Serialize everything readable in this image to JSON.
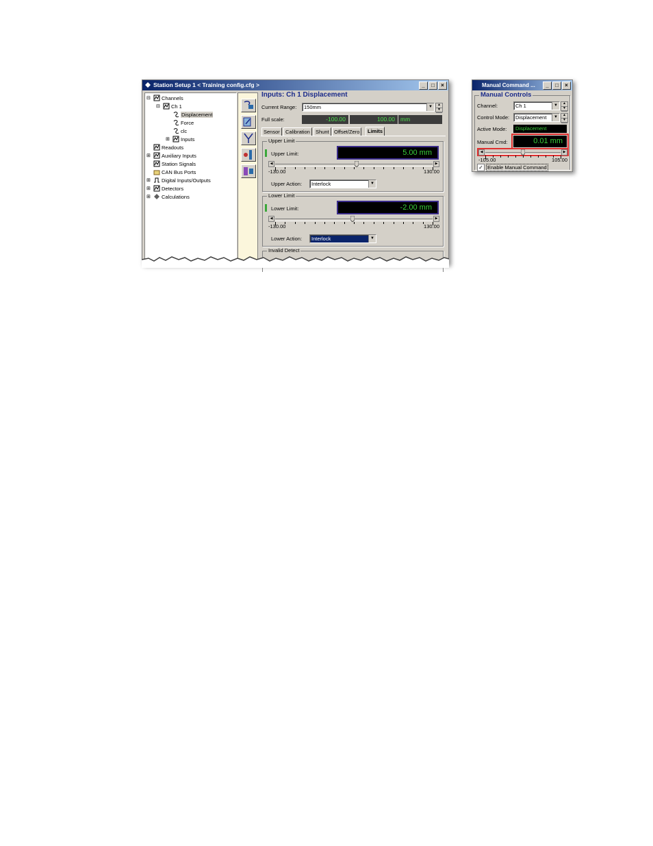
{
  "station_window": {
    "title": "Station Setup 1 < Training config.cfg >",
    "tree": [
      {
        "label": "Channels",
        "expander": "⊟",
        "icon": "channels-icon"
      },
      {
        "label": "Ch 1",
        "expander": "⊟",
        "icon": "channel-icon"
      },
      {
        "label": "Displacement",
        "expander": "",
        "icon": "sensor-icon",
        "selected": true
      },
      {
        "label": "Force",
        "expander": "",
        "icon": "sensor-icon"
      },
      {
        "label": "clc",
        "expander": "",
        "icon": "sensor-icon"
      },
      {
        "label": "Inputs",
        "expander": "⊞",
        "icon": "inputs-icon"
      },
      {
        "label": "Readouts",
        "expander": "",
        "icon": "readouts-icon"
      },
      {
        "label": "Auxiliary Inputs",
        "expander": "⊞",
        "icon": "aux-inputs-icon"
      },
      {
        "label": "Station Signals",
        "expander": "",
        "icon": "signals-icon"
      },
      {
        "label": "CAN Bus Ports",
        "expander": "",
        "icon": "folder-icon"
      },
      {
        "label": "Digital Inputs/Outputs",
        "expander": "⊞",
        "icon": "digital-io-icon"
      },
      {
        "label": "Detectors",
        "expander": "⊞",
        "icon": "detectors-icon"
      },
      {
        "label": "Calculations",
        "expander": "⊞",
        "icon": "calculations-icon"
      }
    ],
    "toolbar_icons": [
      "channel-config-icon",
      "calibration-tool-icon",
      "fork-icon",
      "sensor-probe-icon",
      "station-icon"
    ],
    "panel": {
      "heading": "Inputs: Ch 1 Displacement",
      "current_range_label": "Current Range:",
      "current_range_value": "150mm",
      "full_scale_label": "Full scale:",
      "full_scale_min": "-100.00",
      "full_scale_max": "100.00",
      "full_scale_unit": "mm",
      "tabs": [
        "Sensor",
        "Calibration",
        "Shunt",
        "Offset/Zero",
        "Limits"
      ],
      "active_tab": "Limits",
      "upper": {
        "group_title": "Upper Limit",
        "limit_label": "Upper Limit:",
        "readout": "5.00  mm",
        "slider_min": "-130.00",
        "slider_max": "130.00",
        "slider_value": 5,
        "action_label": "Upper Action:",
        "action_value": "Interlock"
      },
      "lower": {
        "group_title": "Lower Limit",
        "limit_label": "Lower Limit:",
        "readout": "-2.00  mm",
        "slider_min": "-130.00",
        "slider_max": "130.00",
        "slider_value": -2,
        "action_label": "Lower Action:",
        "action_value": "Interlock"
      },
      "invalid_detect_title": "Invalid Detect"
    }
  },
  "manual_window": {
    "title": "Manual Command ...",
    "group_title": "Manual Controls",
    "channel_label": "Channel:",
    "channel_value": "Ch 1",
    "control_mode_label": "Control Mode:",
    "control_mode_value": "Displacement",
    "active_mode_label": "Active Mode:",
    "active_mode_value": "Displacement",
    "manual_cmd_label": "Manual Cmd:",
    "manual_cmd_readout": "0.01  mm",
    "slider_min": "-105.00",
    "slider_max": "105.00",
    "slider_value": 0.01,
    "enable_label": "Enable Manual Command",
    "enable_checked": true,
    "highlight_color": "#e03030"
  },
  "colors": {
    "readout_text": "#3ad13a",
    "title_bar_start": "#0a246a",
    "title_bar_end": "#a6caf0"
  }
}
